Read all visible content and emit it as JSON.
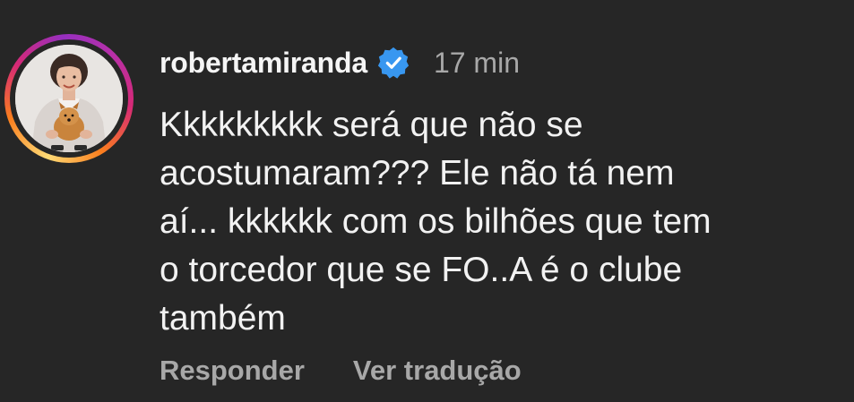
{
  "comment": {
    "username": "robertamiranda",
    "verified_icon": "verified-badge-icon",
    "timestamp": "17 min",
    "text": "Kkkkkkkkk será que não se\nacostumaram??? Ele não tá nem\naí... kkkkkk com os bilhões que tem\no torcedor que se FO..A é o clube\ntambém",
    "avatar_icon": "profile-avatar",
    "actions": {
      "reply_label": "Responder",
      "translate_label": "Ver tradução"
    }
  },
  "colors": {
    "background": "#262626",
    "text_primary": "#f2f2f2",
    "text_secondary": "#a8a8a8",
    "verified_badge": "#3897f0"
  }
}
